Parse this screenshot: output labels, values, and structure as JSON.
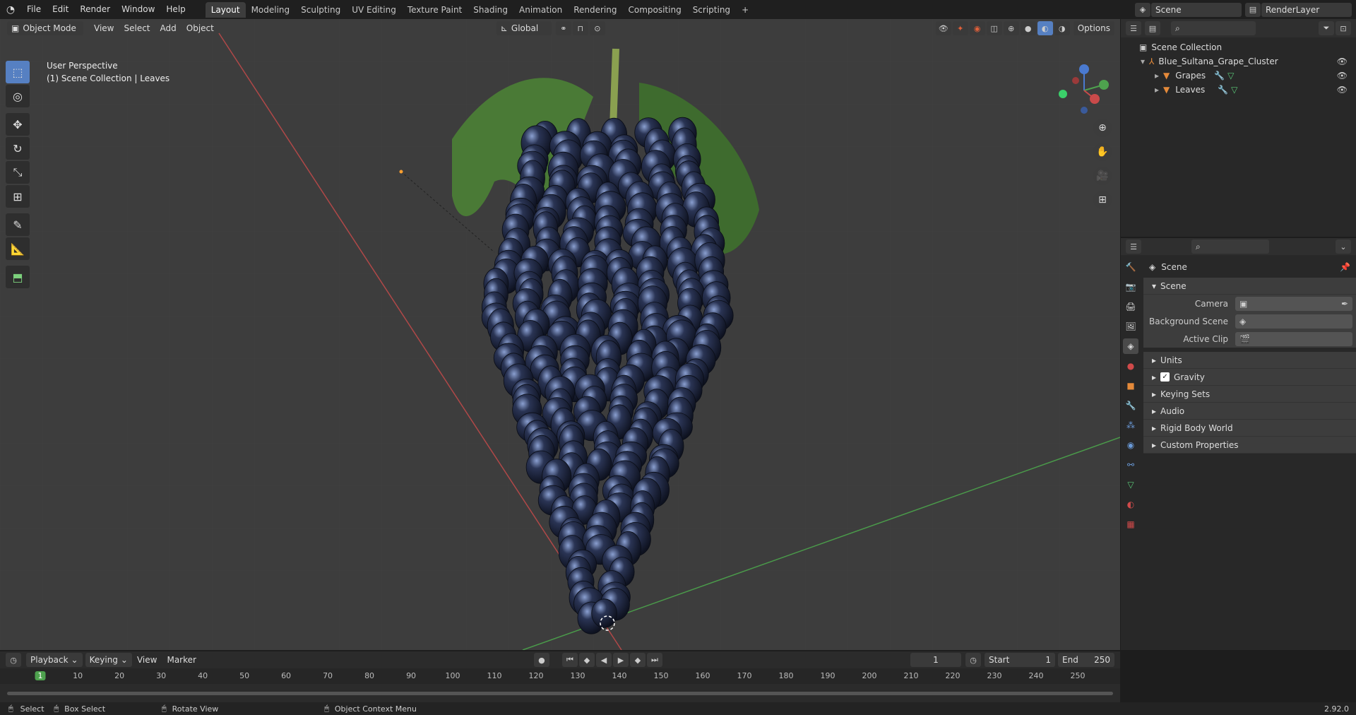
{
  "topbar": {
    "menus": [
      "File",
      "Edit",
      "Render",
      "Window",
      "Help"
    ],
    "tabs": [
      "Layout",
      "Modeling",
      "Sculpting",
      "UV Editing",
      "Texture Paint",
      "Shading",
      "Animation",
      "Rendering",
      "Compositing",
      "Scripting"
    ],
    "active_tab": "Layout",
    "add_tab": "+",
    "scene_name": "Scene",
    "view_layer": "RenderLayer"
  },
  "viewport_header": {
    "mode": "Object Mode",
    "menus": [
      "View",
      "Select",
      "Add",
      "Object"
    ],
    "transform_orientation": "Global",
    "options": "Options"
  },
  "viewport": {
    "perspective": "User Perspective",
    "collection_info": "(1) Scene Collection | Leaves"
  },
  "outliner": {
    "root": "Scene Collection",
    "items": [
      {
        "name": "Blue_Sultana_Grape_Cluster",
        "level": 1
      },
      {
        "name": "Grapes",
        "level": 2
      },
      {
        "name": "Leaves",
        "level": 2
      }
    ]
  },
  "properties": {
    "context": "Scene",
    "section": "Scene",
    "fields": [
      {
        "label": "Camera",
        "value": ""
      },
      {
        "label": "Background Scene",
        "value": ""
      },
      {
        "label": "Active Clip",
        "value": ""
      }
    ],
    "panels": [
      "Units",
      "Gravity",
      "Keying Sets",
      "Audio",
      "Rigid Body World",
      "Custom Properties"
    ],
    "gravity_checked": true
  },
  "timeline": {
    "menus": [
      "Playback",
      "Keying",
      "View",
      "Marker"
    ],
    "current_frame": "1",
    "start_label": "Start",
    "start": "1",
    "end_label": "End",
    "end": "250",
    "ticks": [
      "1",
      "10",
      "20",
      "30",
      "40",
      "50",
      "60",
      "70",
      "80",
      "90",
      "100",
      "110",
      "120",
      "130",
      "140",
      "150",
      "160",
      "170",
      "180",
      "190",
      "200",
      "210",
      "220",
      "230",
      "240",
      "250"
    ]
  },
  "statusbar": {
    "items": [
      "Select",
      "Box Select",
      "Rotate View",
      "Object Context Menu"
    ],
    "version": "2.92.0"
  },
  "colors": {
    "accent": "#5680c2",
    "x_axis": "#c94a4a",
    "y_axis": "#4ea24e",
    "z_axis": "#4a7ad0",
    "grape": "#1a2238",
    "leaf": "#4a7a36"
  },
  "icons": [
    "blender-logo-icon",
    "search-icon",
    "eye-icon",
    "filter-icon",
    "pin-icon",
    "zoom-icon",
    "hand-icon",
    "camera-icon",
    "grid-icon",
    "play-icon"
  ]
}
